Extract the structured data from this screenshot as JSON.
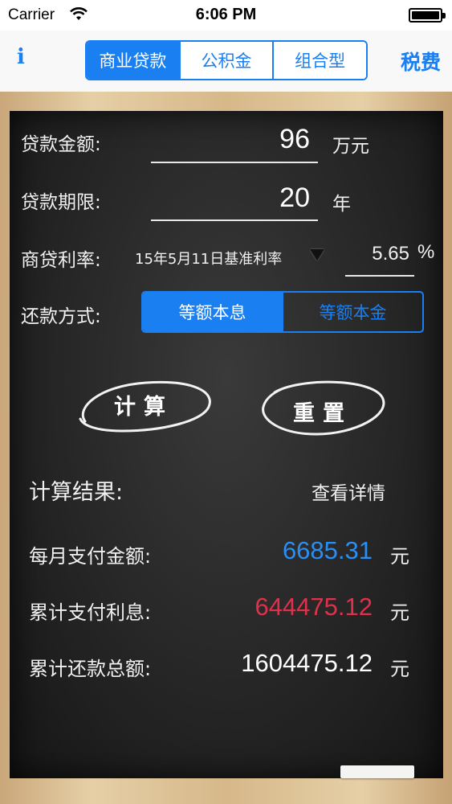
{
  "status": {
    "carrier": "Carrier",
    "time": "6:06 PM"
  },
  "nav": {
    "info_label": "i",
    "tabs": [
      "商业贷款",
      "公积金",
      "组合型"
    ],
    "right_label": "税费"
  },
  "form": {
    "amount_label": "贷款金额:",
    "amount_value": "96",
    "amount_unit": "万元",
    "term_label": "贷款期限:",
    "term_value": "20",
    "term_unit": "年",
    "rate_label": "商贷利率:",
    "rate_option": "15年5月11日基准利率",
    "rate_value": "5.65",
    "rate_unit": "%",
    "method_label": "还款方式:",
    "methods": [
      "等额本息",
      "等额本金"
    ]
  },
  "buttons": {
    "calculate": "计算",
    "reset": "重置"
  },
  "result": {
    "title": "计算结果:",
    "detail_link": "查看详情",
    "monthly_label": "每月支付金额:",
    "monthly_value": "6685.31",
    "interest_label": "累计支付利息:",
    "interest_value": "644475.12",
    "total_label": "累计还款总额:",
    "total_value": "1604475.12",
    "unit": "元"
  },
  "colors": {
    "accent": "#1a7ff0",
    "monthly": "#2a8ff5",
    "interest": "#e0314b",
    "total": "#ffffff"
  }
}
